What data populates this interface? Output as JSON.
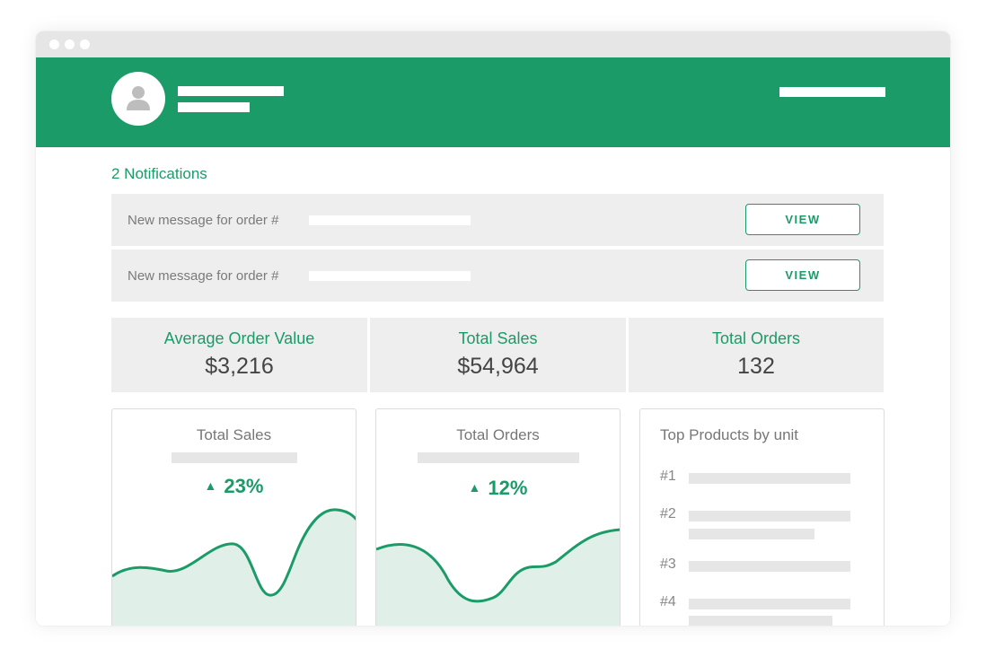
{
  "notifications": {
    "title": "2 Notifications",
    "items": [
      {
        "text": "New message for order #",
        "button": "VIEW"
      },
      {
        "text": "New message for order #",
        "button": "VIEW"
      }
    ]
  },
  "stats": [
    {
      "label": "Average Order Value",
      "value": "$3,216"
    },
    {
      "label": "Total Sales",
      "value": "$54,964"
    },
    {
      "label": "Total Orders",
      "value": "132"
    }
  ],
  "cards": {
    "sales": {
      "title": "Total Sales",
      "change": "23%",
      "trend": "up"
    },
    "orders": {
      "title": "Total Orders",
      "change": "12%",
      "trend": "up"
    },
    "top_products": {
      "title": "Top Products by unit",
      "ranks": [
        "#1",
        "#2",
        "#3",
        "#4"
      ]
    }
  },
  "colors": {
    "accent": "#1b9b67",
    "panel": "#eeeeee",
    "area_fill": "#e0f0e8"
  },
  "icons": {
    "up_arrow": "▲"
  }
}
